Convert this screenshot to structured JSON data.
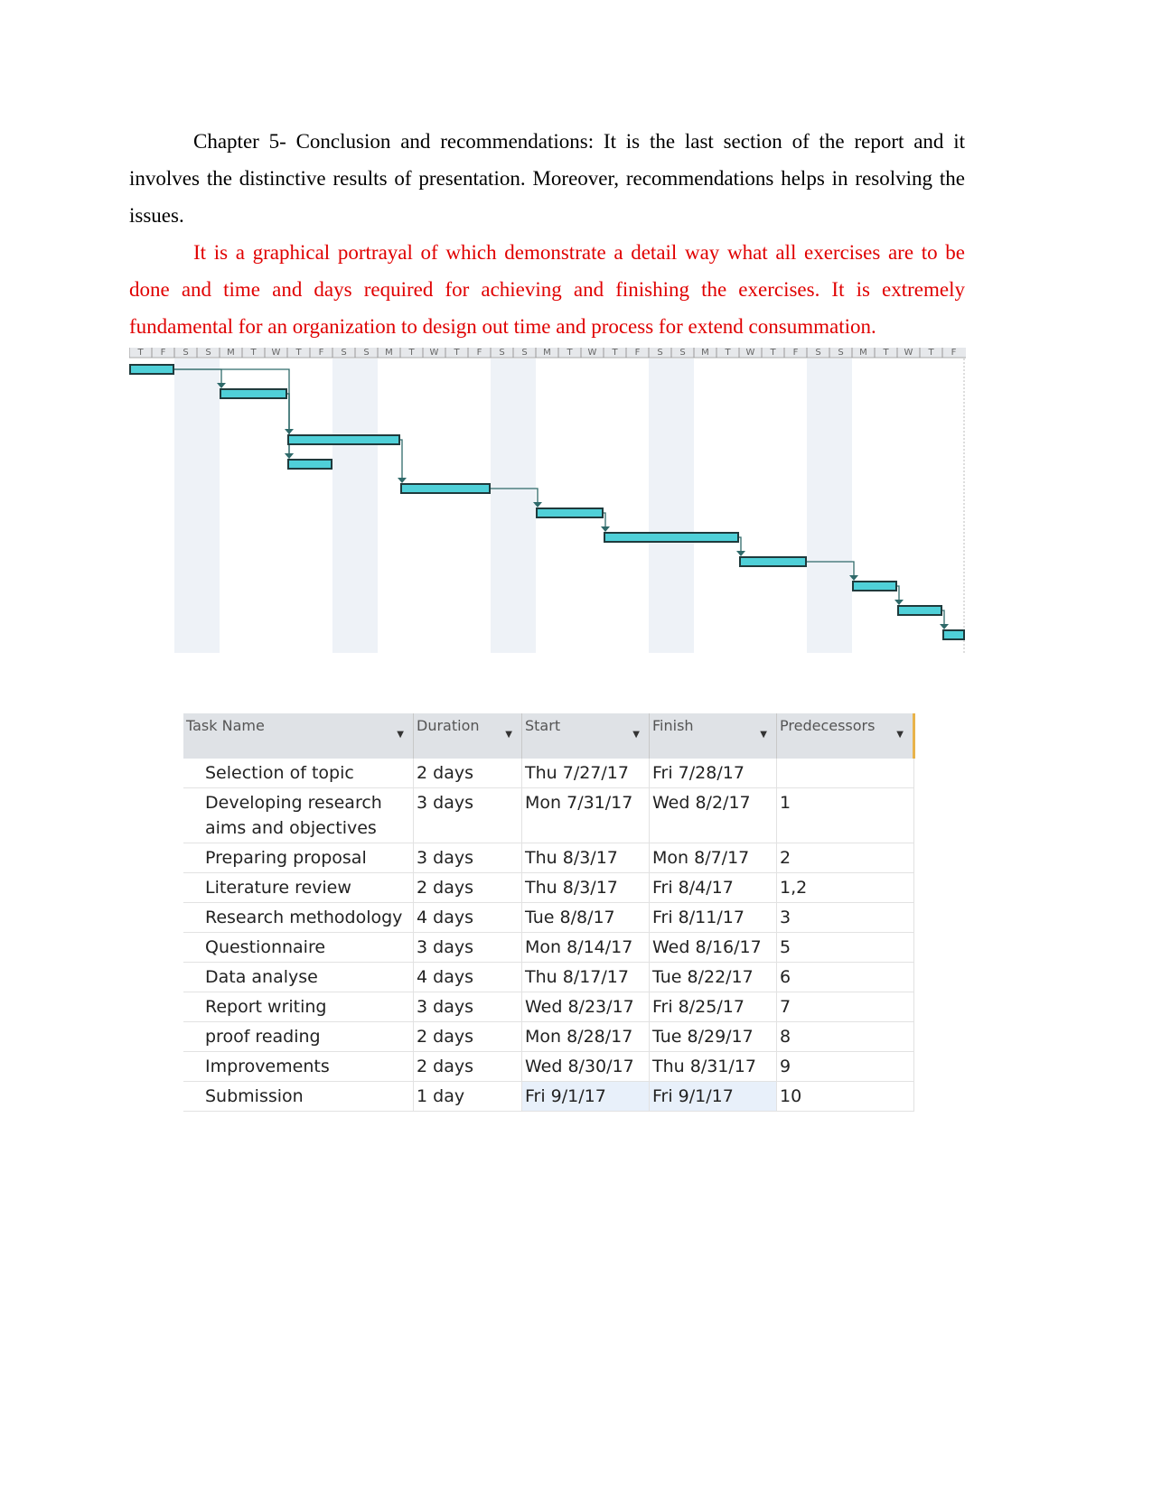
{
  "paragraphs": [
    "Chapter 5-  Conclusion and recommendations: It is the last section of the report and it involves the distinctive results of presentation. Moreover, recommendations helps in resolving the issues.",
    "It is a graphical portrayal of which demonstrate a detail way what all exercises are to be done and time and days required for achieving and finishing the exercises. It is extremely fundamental for an organization to design out time and process for extend consummation."
  ],
  "colors": {
    "highlight_text": "#e00000",
    "bar": "#4fd0d8",
    "bar_border": "#1f3a3c",
    "link": "#2f6a6a",
    "weekend": "#eef2f7"
  },
  "gantt": {
    "start_date": "2017-07-27",
    "day_letters": [
      "T",
      "F",
      "S",
      "S",
      "M",
      "T",
      "W"
    ]
  },
  "table": {
    "headers": [
      "Task Name",
      "Duration",
      "Start",
      "Finish",
      "Predecessors"
    ],
    "rows": [
      {
        "name": "Selection of topic",
        "duration": "2 days",
        "start": "Thu 7/27/17",
        "finish": "Fri 7/28/17",
        "pred": ""
      },
      {
        "name": "Developing research aims and objectives",
        "duration": "3 days",
        "start": "Mon 7/31/17",
        "finish": "Wed 8/2/17",
        "pred": "1"
      },
      {
        "name": "Preparing proposal",
        "duration": "3 days",
        "start": "Thu 8/3/17",
        "finish": "Mon 8/7/17",
        "pred": "2"
      },
      {
        "name": "Literature review",
        "duration": "2 days",
        "start": "Thu 8/3/17",
        "finish": "Fri 8/4/17",
        "pred": "1,2"
      },
      {
        "name": "Research methodology",
        "duration": "4 days",
        "start": "Tue 8/8/17",
        "finish": "Fri 8/11/17",
        "pred": "3"
      },
      {
        "name": "Questionnaire",
        "duration": "3 days",
        "start": "Mon 8/14/17",
        "finish": "Wed 8/16/17",
        "pred": "5"
      },
      {
        "name": "Data analyse",
        "duration": "4 days",
        "start": "Thu 8/17/17",
        "finish": "Tue 8/22/17",
        "pred": "6"
      },
      {
        "name": "Report writing",
        "duration": "3 days",
        "start": "Wed 8/23/17",
        "finish": "Fri 8/25/17",
        "pred": "7"
      },
      {
        "name": "proof reading",
        "duration": "2 days",
        "start": "Mon 8/28/17",
        "finish": "Tue 8/29/17",
        "pred": "8"
      },
      {
        "name": "Improvements",
        "duration": "2 days",
        "start": "Wed 8/30/17",
        "finish": "Thu 8/31/17",
        "pred": "9"
      },
      {
        "name": "Submission",
        "duration": "1 day",
        "start": "Fri 9/1/17",
        "finish": "Fri 9/1/17",
        "pred": "10"
      }
    ]
  }
}
